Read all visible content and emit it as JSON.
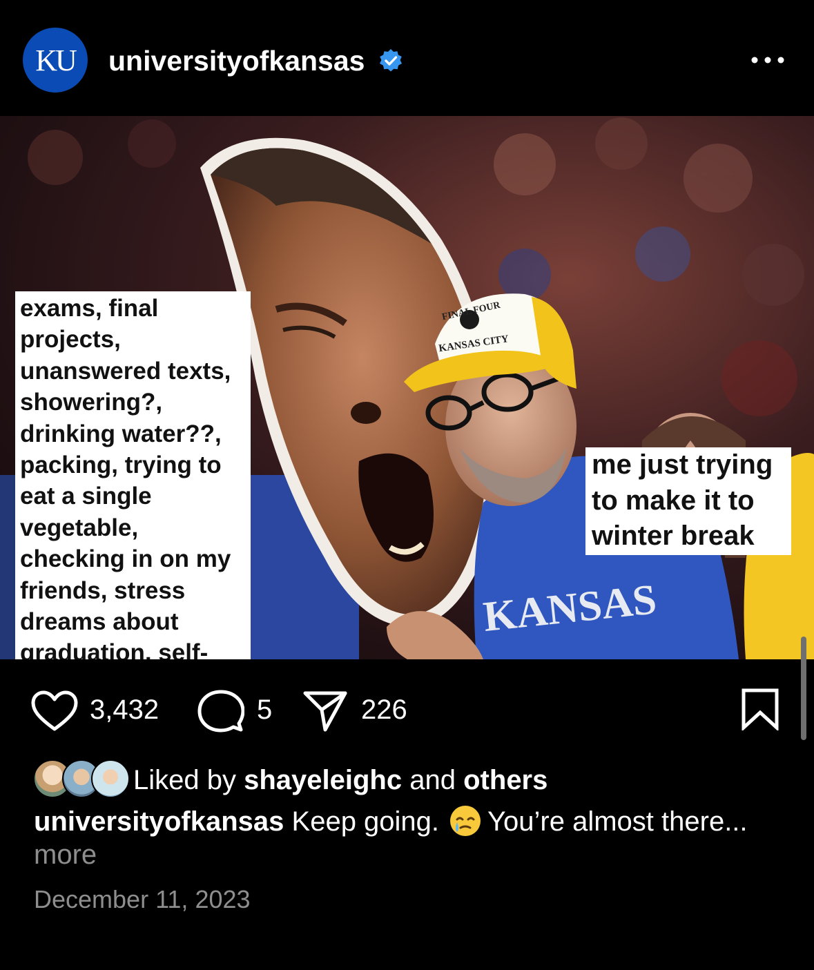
{
  "header": {
    "avatar_text": "KU",
    "username": "universityofkansas",
    "verified_icon": "verified-badge-icon",
    "more_icon": "more-options-icon"
  },
  "post": {
    "image_caption_left": "exams, final\nprojects,\nunanswered texts,\nshowering?,\ndrinking water??,\npacking, trying to\neat a single\nvegetable,\nchecking in on my\nfriends, stress\ndreams about\ngraduation, self-\nimposed pressure\nto succeed",
    "image_caption_right": "me just trying\nto make it to\nwinter break",
    "hat_text_top": "FINAL FOUR",
    "hat_text_bottom": "KANSAS CITY",
    "shirt_text": "KANSAS"
  },
  "actions": {
    "likes": "3,432",
    "comments": "5",
    "shares": "226"
  },
  "likes": {
    "prefix": "Liked by",
    "user": "shayeleighc",
    "connector": "and",
    "others": "others"
  },
  "caption": {
    "username": "universityofkansas",
    "text_a": "Keep going.",
    "text_b": "You’re almost there...",
    "more": "more"
  },
  "date": "December 11, 2023",
  "colors": {
    "background": "#000000",
    "ku_blue": "#0a4bb5",
    "verified_blue": "#3797f0",
    "muted": "#8e8e8e"
  }
}
